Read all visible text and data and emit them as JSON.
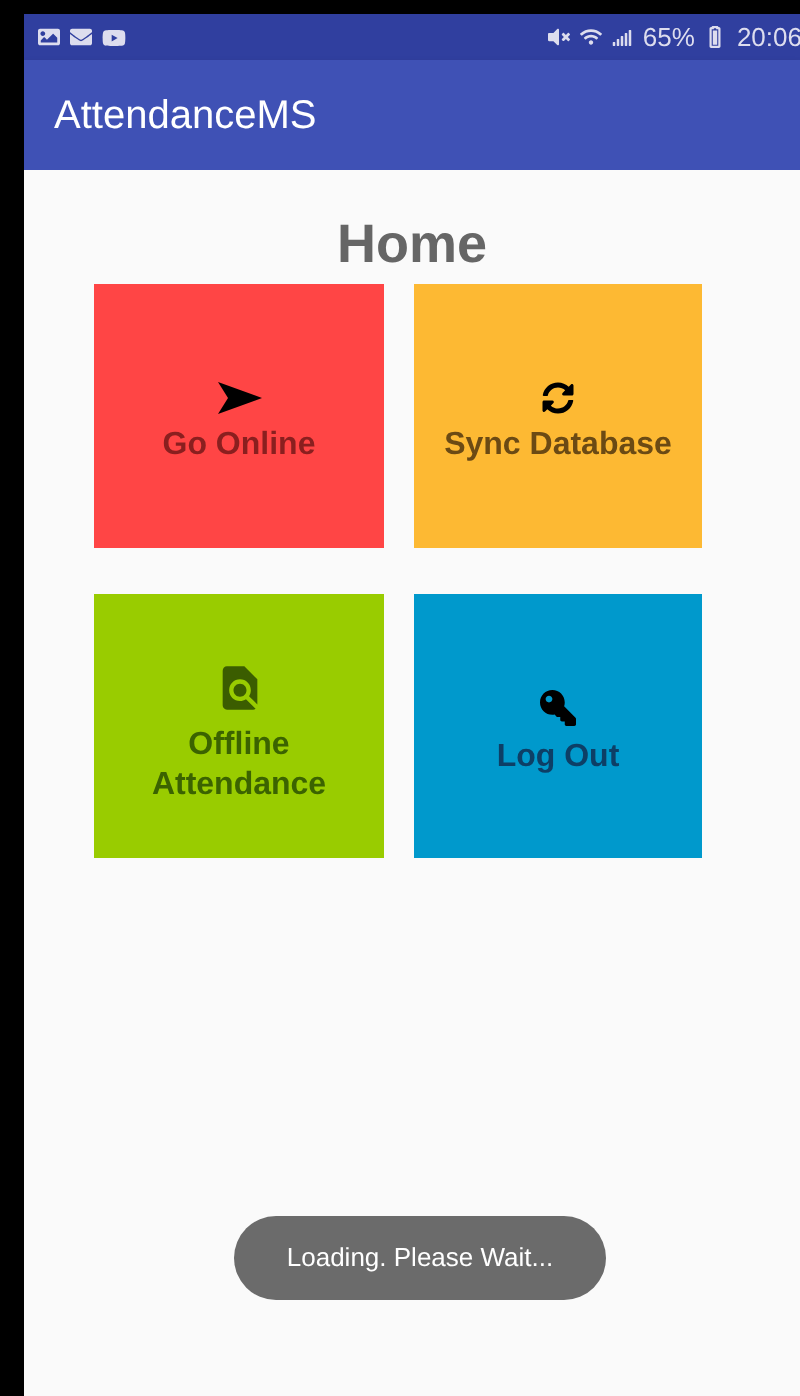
{
  "status_bar": {
    "battery": "65%",
    "time": "20:06"
  },
  "app_bar": {
    "title": "AttendanceMS"
  },
  "heading": "Home",
  "tiles": [
    {
      "kind": "online",
      "label": "Go Online",
      "color": "#ff4545"
    },
    {
      "kind": "sync",
      "label": "Sync Database",
      "color": "#fdb933"
    },
    {
      "kind": "offline",
      "label": "Offline Attendance",
      "color": "#99cc00"
    },
    {
      "kind": "logout",
      "label": "Log Out",
      "color": "#0099cc"
    }
  ],
  "toast": "Loading. Please Wait..."
}
